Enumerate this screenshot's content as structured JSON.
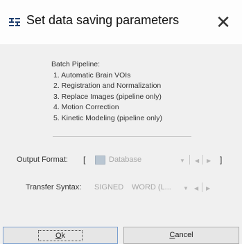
{
  "window": {
    "title": "Set  data saving parameters",
    "close_glyph": "✕"
  },
  "info": {
    "heading": "Batch Pipeline:",
    "items": [
      "1. Automatic Brain VOIs",
      "2. Registration and Normalization",
      "3. Replace Images (pipeline only)",
      "4. Motion Correction",
      "5. Kinetic Modeling (pipeline only)"
    ]
  },
  "output_format": {
    "label": "Output Format:",
    "open_bracket": "[",
    "value": "Database",
    "close_bracket": "]",
    "dropdown_arrow": "▼",
    "prev_arrow": "◀",
    "next_arrow": "▶"
  },
  "transfer_syntax": {
    "label": "Transfer Syntax:",
    "signed": "SIGNED",
    "value": "WORD (L...",
    "dropdown_arrow": "▼",
    "prev_arrow": "◀",
    "next_arrow": "▶"
  },
  "buttons": {
    "ok_mnemonic": "O",
    "ok_rest": "k",
    "cancel_mnemonic": "C",
    "cancel_rest": "ancel"
  }
}
